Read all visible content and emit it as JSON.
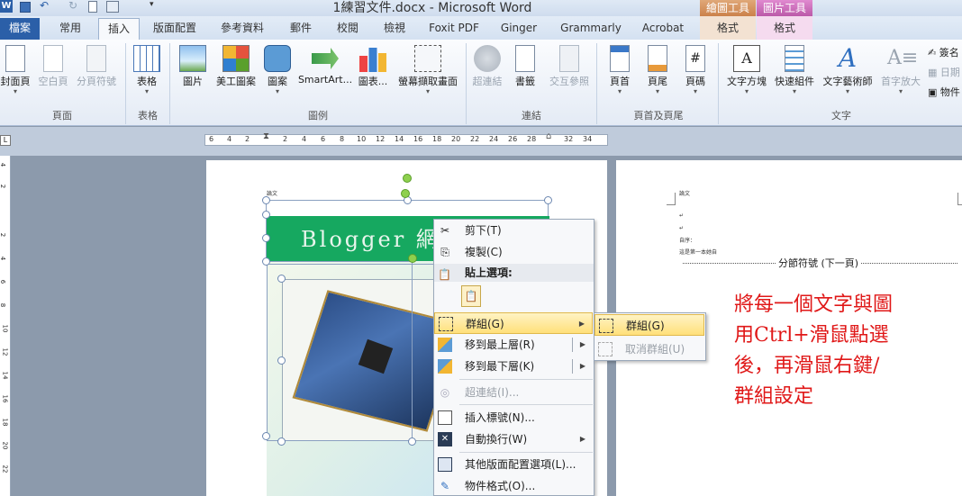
{
  "window": {
    "title": "1練習文件.docx - Microsoft Word"
  },
  "context_tabs": [
    "繪圖工具",
    "圖片工具"
  ],
  "tabs": [
    "檔案",
    "常用",
    "插入",
    "版面配置",
    "參考資料",
    "郵件",
    "校閱",
    "檢視",
    "Foxit PDF",
    "Ginger",
    "Grammarly",
    "Acrobat",
    "格式",
    "格式"
  ],
  "ribbon": {
    "buttons": [
      "封面頁",
      "空白頁",
      "分頁符號",
      "表格",
      "圖片",
      "美工圖案",
      "圖案",
      "SmartArt...",
      "圖表...",
      "螢幕擷取畫面",
      "超連結",
      "書籤",
      "交互參照",
      "頁首",
      "頁尾",
      "頁碼",
      "文字方塊",
      "快速組件",
      "文字藝術師",
      "首字放大"
    ],
    "right_items": [
      "簽名",
      "日期",
      "物件"
    ],
    "groups": [
      "頁面",
      "表格",
      "圖例",
      "連結",
      "頁首及頁尾",
      "文字"
    ]
  },
  "ruler": {
    "ticks": [
      "6",
      "4",
      "2",
      "2",
      "4",
      "6",
      "8",
      "10",
      "12",
      "14",
      "16",
      "18",
      "20",
      "22",
      "24",
      "26",
      "28",
      "32",
      "34"
    ],
    "vticks": [
      "4",
      "2",
      "2",
      "4",
      "6",
      "8",
      "10",
      "12",
      "14",
      "16",
      "18",
      "20",
      "22"
    ]
  },
  "page1": {
    "header": "論文",
    "banner": "Blogger 網"
  },
  "page2": {
    "header": "論文",
    "lines": [
      "自序：",
      "這是第一本她自"
    ],
    "section_break": "分節符號 (下一頁)"
  },
  "context_menu": {
    "items": [
      {
        "label": "剪下(T)",
        "icon": "scissors-icon"
      },
      {
        "label": "複製(C)",
        "icon": "copy-icon"
      },
      {
        "label": "群組(G)",
        "icon": "group-icon",
        "submenu": true,
        "highlight": true
      },
      {
        "label": "移到最上層(R)",
        "icon": "bring-front-icon",
        "submenu": true
      },
      {
        "label": "移到最下層(K)",
        "icon": "send-back-icon",
        "submenu": true
      },
      {
        "label": "超連結(I)...",
        "icon": "hyperlink-icon",
        "disabled": true
      },
      {
        "label": "插入標號(N)...",
        "icon": "caption-icon"
      },
      {
        "label": "自動換行(W)",
        "icon": "wrap-icon",
        "submenu": true
      },
      {
        "label": "其他版面配置選項(L)...",
        "icon": "layout-icon"
      },
      {
        "label": "物件格式(O)...",
        "icon": "format-icon"
      }
    ],
    "paste_header": "貼上選項:"
  },
  "submenu": {
    "items": [
      {
        "label": "群組(G)"
      },
      {
        "label": "取消群組(U)",
        "disabled": true
      }
    ]
  },
  "annotation": "將每一個文字與圖用Ctrl+滑鼠點選後，再滑鼠右鍵/群組設定"
}
